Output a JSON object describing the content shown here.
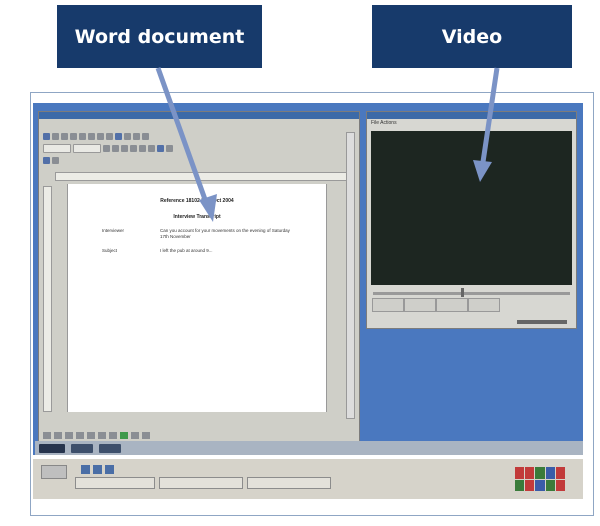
{
  "callouts": {
    "word": "Word document",
    "video": "Video"
  },
  "word_window": {
    "document_heading": "Reference 18102 17th Oct 2004",
    "document_subheading": "Interview Transcript",
    "rows": [
      {
        "label": "Interviewer",
        "text": "Can you account for your movements on the evening of Saturday 17th November"
      },
      {
        "label": "Subject",
        "text": "I left the pub at around 9..."
      }
    ]
  },
  "video_window": {
    "menu": "File   Actions"
  },
  "colors": {
    "callout_bg": "#173a6b",
    "arrow": "#7b93c6",
    "desktop": "#4a78bf",
    "video_screen": "#1d2621"
  }
}
